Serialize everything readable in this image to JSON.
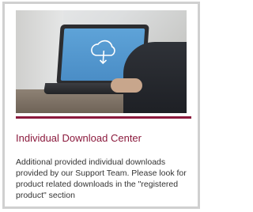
{
  "card": {
    "image_icon": "cloud-download-icon",
    "title": "Individual Download Center",
    "description": "Additional provided individual downloads provided by our Support Team. Please look for product related downloads in the \"registered product\" section"
  },
  "colors": {
    "accent": "#8b1a3d",
    "text": "#333333",
    "border": "#d0d0d0",
    "screen": "#4a8dc6"
  }
}
